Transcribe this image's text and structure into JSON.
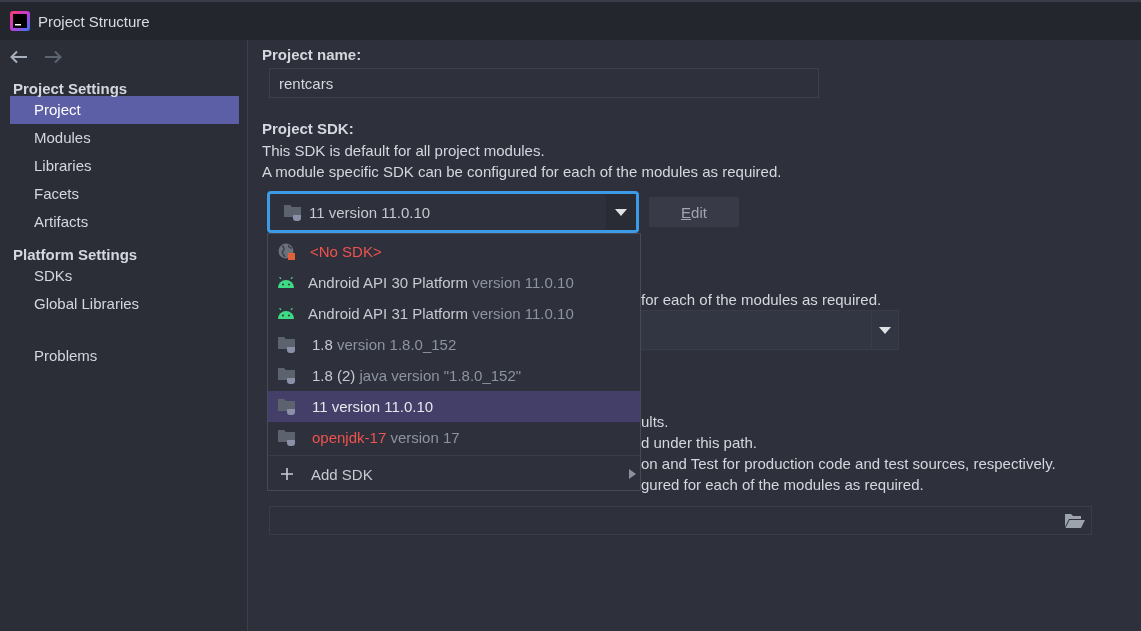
{
  "window": {
    "title": "Project Structure"
  },
  "sidebar": {
    "sections": [
      {
        "title": "Project Settings",
        "items": [
          {
            "label": "Project",
            "selected": true
          },
          {
            "label": "Modules",
            "selected": false
          },
          {
            "label": "Libraries",
            "selected": false
          },
          {
            "label": "Facets",
            "selected": false
          },
          {
            "label": "Artifacts",
            "selected": false
          }
        ]
      },
      {
        "title": "Platform Settings",
        "items": [
          {
            "label": "SDKs",
            "selected": false
          },
          {
            "label": "Global Libraries",
            "selected": false
          }
        ]
      }
    ],
    "extra_items": [
      {
        "label": "Problems",
        "selected": false
      }
    ]
  },
  "project_name": {
    "label": "Project name:",
    "value": "rentcars"
  },
  "project_sdk": {
    "label": "Project SDK:",
    "description": [
      "This SDK is default for all project modules.",
      "A module specific SDK can be configured for each of the modules as required."
    ],
    "value": "11 version 11.0.10",
    "edit_button": "Edit"
  },
  "sdk_popup": {
    "items": [
      {
        "kind": "none",
        "name": "<No SDK>",
        "error": true,
        "selected": false
      },
      {
        "kind": "android",
        "name": "Android API 30 Platform",
        "version": "version 11.0.10",
        "error": false,
        "selected": false
      },
      {
        "kind": "android",
        "name": "Android API 31 Platform",
        "version": "version 11.0.10",
        "error": false,
        "selected": false
      },
      {
        "kind": "jdk",
        "name": "1.8",
        "version": "version 1.8.0_152",
        "error": false,
        "selected": false
      },
      {
        "kind": "jdk",
        "name": "1.8 (2)",
        "version": "java version \"1.8.0_152\"",
        "error": false,
        "selected": false
      },
      {
        "kind": "jdk",
        "name": "11",
        "version": "version 11.0.10",
        "error": false,
        "selected": true
      },
      {
        "kind": "jdk",
        "name": "openjdk-17",
        "version": "version 17",
        "error": true,
        "selected": false
      }
    ],
    "add_item": "Add SDK"
  },
  "covered_section": {
    "lines_top": [
      "for each of the modules as required."
    ],
    "lines_bottom": [
      "ults.",
      "d under this path.",
      "on and Test for production code and test sources, respectively.",
      "gured for each of the modules as required."
    ]
  }
}
